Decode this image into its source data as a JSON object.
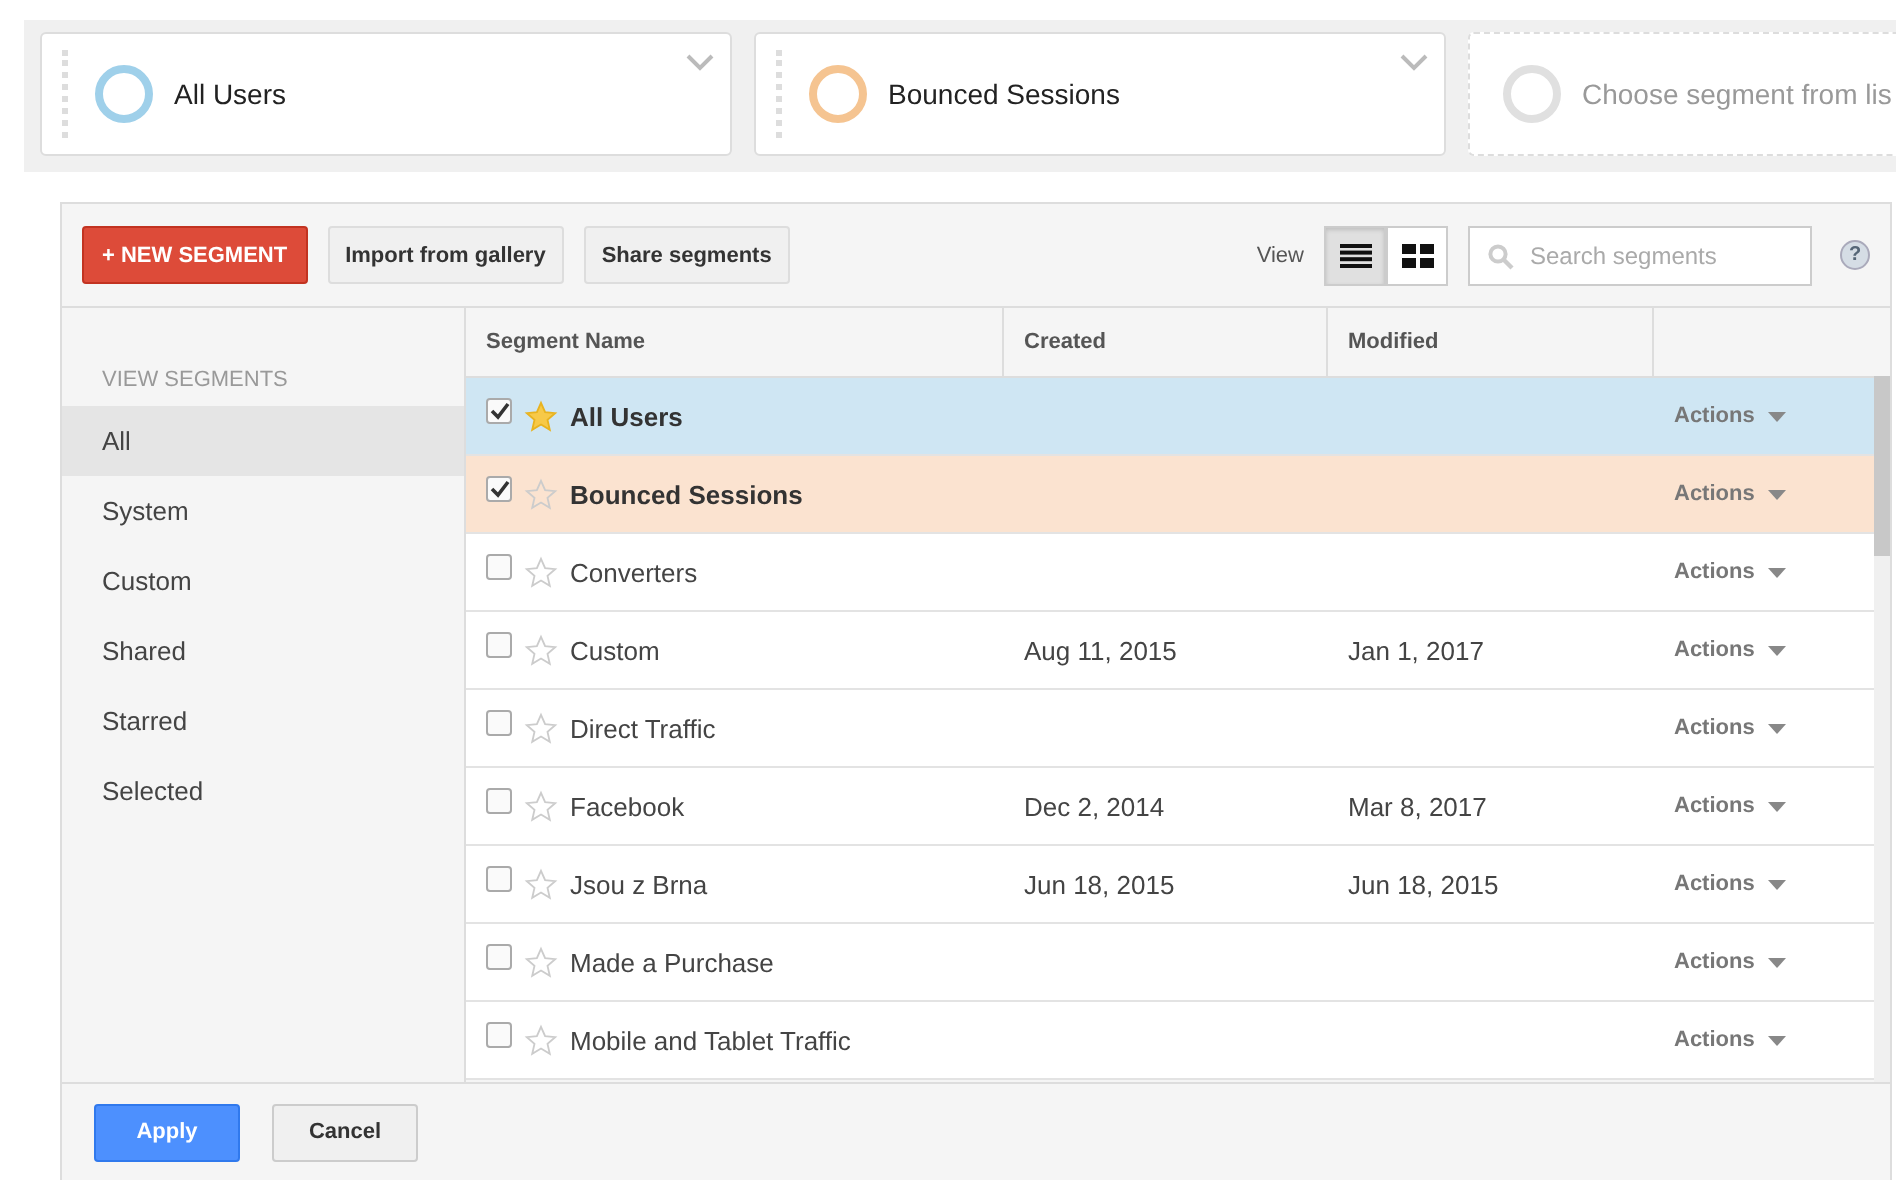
{
  "segment_bar": [
    {
      "kind": "chosen",
      "label": "All Users",
      "color": "#9fd0ea"
    },
    {
      "kind": "chosen",
      "label": "Bounced Sessions",
      "color": "#f5c491"
    },
    {
      "kind": "empty",
      "label": "Choose segment from lis",
      "color": "#e0e0e0"
    }
  ],
  "toolbar": {
    "new_button": "+ NEW SEGMENT",
    "buttons": [
      "Import from gallery",
      "Share segments"
    ],
    "view_label": "View",
    "views": [
      {
        "kind": "list",
        "selected": true
      },
      {
        "kind": "grid",
        "selected": false
      }
    ],
    "search": {
      "placeholder": "Search segments"
    },
    "help": "?"
  },
  "sidebar": {
    "heading": "VIEW SEGMENTS",
    "items": [
      {
        "label": "All",
        "selected": true
      },
      {
        "label": "System",
        "selected": false
      },
      {
        "label": "Custom",
        "selected": false
      },
      {
        "label": "Shared",
        "selected": false
      },
      {
        "label": "Starred",
        "selected": false
      },
      {
        "label": "Selected",
        "selected": false
      }
    ]
  },
  "table": {
    "columns": [
      "Segment Name",
      "Created",
      "Modified"
    ],
    "rows": [
      {
        "name": "All Users",
        "created": "",
        "modified": "",
        "checked": true,
        "starred": true,
        "color": "#cfe6f3",
        "action": "Actions"
      },
      {
        "name": "Bounced Sessions",
        "created": "",
        "modified": "",
        "checked": true,
        "starred": false,
        "color": "#fbe3d0",
        "action": "Actions"
      },
      {
        "name": "Converters",
        "checked": false,
        "starred": false,
        "action": "Actions"
      },
      {
        "name": "Custom",
        "created": "Aug 11, 2015",
        "modified": "Jan 1, 2017",
        "checked": false,
        "starred": false,
        "action": "Actions"
      },
      {
        "name": "Direct Traffic",
        "checked": false,
        "starred": false,
        "action": "Actions"
      },
      {
        "name": "Facebook",
        "created": "Dec 2, 2014",
        "modified": "Mar 8, 2017",
        "checked": false,
        "starred": false,
        "action": "Actions"
      },
      {
        "name": "Jsou z Brna",
        "created": "Jun 18, 2015",
        "modified": "Jun 18, 2015",
        "checked": false,
        "starred": false,
        "action": "Actions"
      },
      {
        "name": "Made a Purchase",
        "checked": false,
        "starred": false,
        "action": "Actions"
      },
      {
        "name": "Mobile and Tablet Traffic",
        "checked": false,
        "starred": false,
        "action": "Actions"
      }
    ]
  },
  "footer": {
    "buttons": [
      {
        "kind": "primary",
        "label": "Apply"
      },
      {
        "kind": "secondary",
        "label": "Cancel"
      }
    ]
  }
}
